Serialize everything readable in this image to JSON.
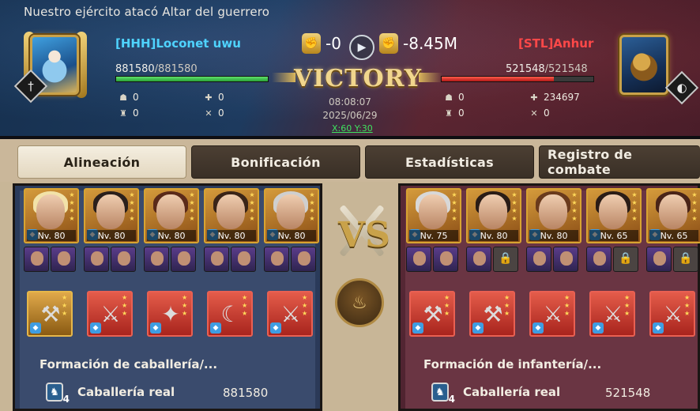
{
  "battle_title": "Nuestro ejército atacó Altar del guerrero",
  "left_player": {
    "name": "[HHH]Loconet uwu",
    "hp_current": "881580",
    "hp_max": "/881580",
    "hp_fraction": 1.0,
    "stats": [
      "0",
      "0",
      "0",
      "0"
    ],
    "color": "#4fd3ff"
  },
  "right_player": {
    "name": "[STL]Anhur",
    "hp_current": "521548",
    "hp_max": "/521548",
    "hp_fraction": 0.74,
    "stats": [
      "0",
      "234697",
      "0",
      "0"
    ],
    "color": "#ff4848"
  },
  "score": {
    "left": "-0",
    "right": "-8.45M"
  },
  "result": "VICTORY",
  "time": "08:08:07",
  "date": "2025/06/29",
  "coords": "X:60 Y:30",
  "tabs": [
    {
      "label": "Alineación",
      "active": true
    },
    {
      "label": "Bonificación",
      "active": false
    },
    {
      "label": "Estadísticas",
      "active": false
    },
    {
      "label": "Registro de combate",
      "active": false
    }
  ],
  "left_heroes": [
    {
      "level": "Nv. 80",
      "hair": "#f2e2a8"
    },
    {
      "level": "Nv. 80",
      "hair": "#2a1f1c"
    },
    {
      "level": "Nv. 80",
      "hair": "#5a2a1a"
    },
    {
      "level": "Nv. 80",
      "hair": "#3a2418"
    },
    {
      "level": "Nv. 80",
      "hair": "#cfcfcf"
    }
  ],
  "right_heroes": [
    {
      "level": "Nv. 75",
      "hair": "#d8d8d8"
    },
    {
      "level": "Nv. 80",
      "hair": "#2a1c16"
    },
    {
      "level": "Nv. 80",
      "hair": "#6a3a1c"
    },
    {
      "level": "Nv. 65",
      "hair": "#2a1c16"
    },
    {
      "level": "Nv. 65",
      "hair": "#4a2418"
    }
  ],
  "vs_label": "VS",
  "left_formation": {
    "title": "Formación de caballería/...",
    "unit": "Caballería real",
    "unit_tier": "4",
    "count": "881580"
  },
  "right_formation": {
    "title": "Formación de infantería/...",
    "unit": "Caballería real",
    "unit_tier": "4",
    "count": "521548"
  }
}
